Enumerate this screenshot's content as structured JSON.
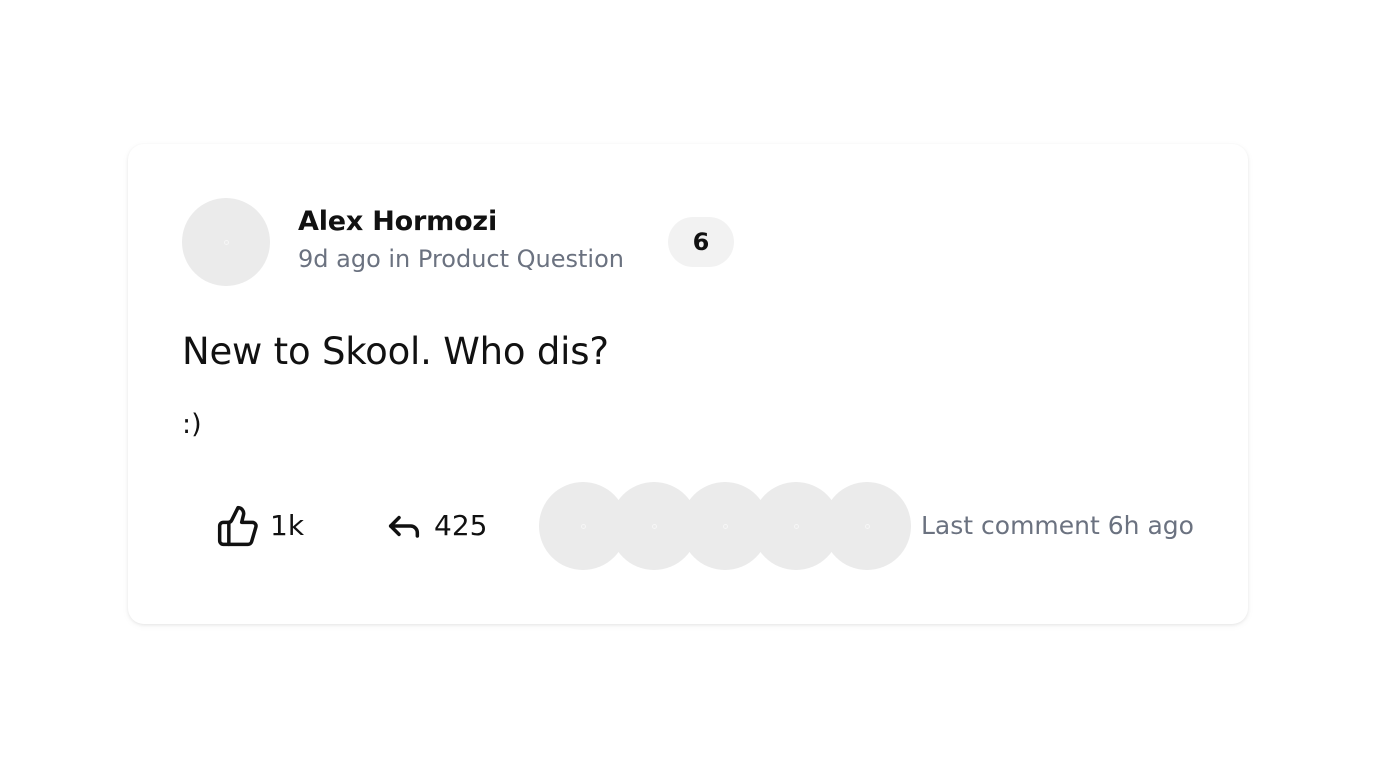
{
  "post": {
    "author": {
      "name": "Alex Hormozi",
      "avatar": "avatar-placeholder",
      "level": "6"
    },
    "meta": {
      "time_ago": "9d ago",
      "separator": "in",
      "category": "Product Question",
      "full": "9d ago in Product Question"
    },
    "title": "New to Skool. Who dis?",
    "body": ":)",
    "likes": {
      "icon": "thumbs-up-icon",
      "count": "1k"
    },
    "comments": {
      "icon": "reply-icon",
      "count": "425"
    },
    "commenter_avatars": [
      "avatar-placeholder",
      "avatar-placeholder",
      "avatar-placeholder",
      "avatar-placeholder",
      "avatar-placeholder"
    ],
    "last_comment": "Last comment 6h ago"
  },
  "colors": {
    "text_primary": "#111111",
    "text_secondary": "#6b7280",
    "avatar_placeholder": "#ebebeb",
    "badge_bg": "#f2f2f2",
    "card_bg": "#ffffff"
  }
}
